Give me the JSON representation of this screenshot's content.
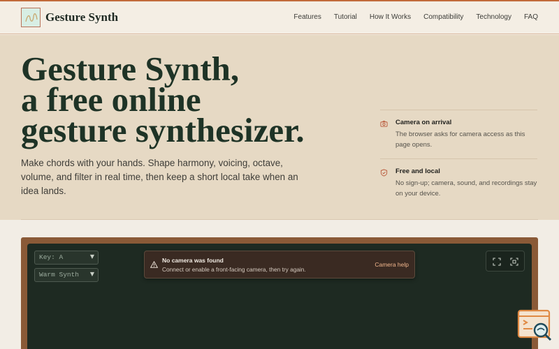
{
  "header": {
    "brand": "Gesture Synth",
    "logo_icon": "squiggle-logo-icon",
    "nav": [
      "Features",
      "Tutorial",
      "How It Works",
      "Compatibility",
      "Technology",
      "FAQ"
    ]
  },
  "hero": {
    "title_lines": [
      "Gesture Synth,",
      "a free online",
      "gesture synthesizer."
    ],
    "subtitle": "Make chords with your hands. Shape harmony, voicing, octave, volume, and filter in real time, then keep a short local take when an idea lands.",
    "features": [
      {
        "icon": "camera-icon",
        "title": "Camera on arrival",
        "text": "The browser asks for camera access as this page opens."
      },
      {
        "icon": "shield-check-icon",
        "title": "Free and local",
        "text": "No sign-up; camera, sound, and recordings stay on your device."
      }
    ]
  },
  "app": {
    "key_select": "Key: A",
    "sound_select": "Warm Synth",
    "toast": {
      "icon": "warning-icon",
      "title": "No camera was found",
      "message": "Connect or enable a front-facing camera, then try again.",
      "action": "Camera help"
    },
    "tools": [
      "fullscreen-icon",
      "focus-scan-icon"
    ]
  },
  "floating_badge": {
    "icon": "code-search-icon"
  },
  "colors": {
    "accent": "#c26a3a",
    "hero_bg": "#e6d9c4",
    "title_green": "#1e3326",
    "panel_bg": "#1e2a22",
    "frame_brown": "#8a5a37",
    "toast_bg": "#3a2a22",
    "toast_link": "#f0b58c"
  }
}
